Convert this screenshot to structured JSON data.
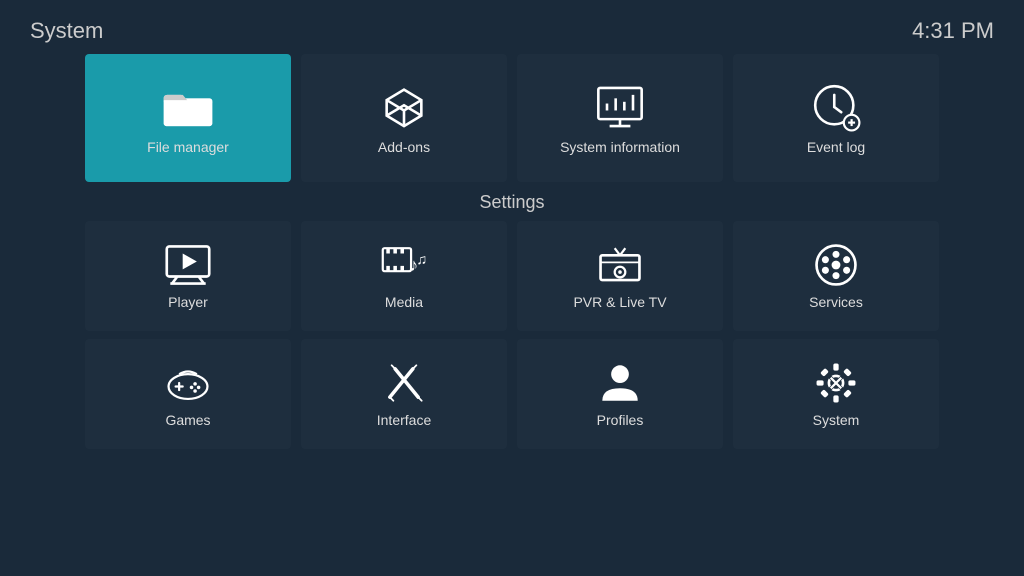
{
  "header": {
    "title": "System",
    "time": "4:31 PM"
  },
  "top_tiles": [
    {
      "id": "file-manager",
      "label": "File manager",
      "active": true
    },
    {
      "id": "add-ons",
      "label": "Add-ons",
      "active": false
    },
    {
      "id": "system-information",
      "label": "System information",
      "active": false
    },
    {
      "id": "event-log",
      "label": "Event log",
      "active": false
    }
  ],
  "settings_label": "Settings",
  "settings_row1": [
    {
      "id": "player",
      "label": "Player"
    },
    {
      "id": "media",
      "label": "Media"
    },
    {
      "id": "pvr-live-tv",
      "label": "PVR & Live TV"
    },
    {
      "id": "services",
      "label": "Services"
    }
  ],
  "settings_row2": [
    {
      "id": "games",
      "label": "Games"
    },
    {
      "id": "interface",
      "label": "Interface"
    },
    {
      "id": "profiles",
      "label": "Profiles"
    },
    {
      "id": "system",
      "label": "System"
    }
  ]
}
